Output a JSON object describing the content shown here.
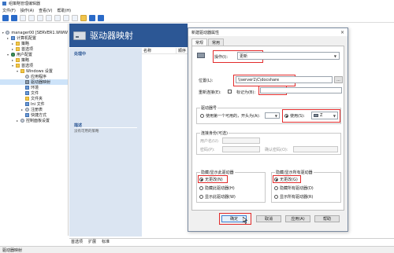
{
  "window": {
    "title": "组策略管理编辑器"
  },
  "menu": [
    "文件(F)",
    "操作(A)",
    "查看(V)",
    "帮助(H)"
  ],
  "tree": [
    {
      "label": "manager00 [SERVER1.WWW",
      "icon": "gpo-icon",
      "indent": 0,
      "twisty": "▾"
    },
    {
      "label": "计算机配置",
      "icon": "computer-config-icon",
      "indent": 1,
      "twisty": "▸"
    },
    {
      "label": "策略",
      "icon": "folder-icon",
      "indent": 2,
      "twisty": "▸"
    },
    {
      "label": "首选项",
      "icon": "folder-icon",
      "indent": 2,
      "twisty": "▸"
    },
    {
      "label": "用户配置",
      "icon": "user-config-icon",
      "indent": 1,
      "twisty": "▾"
    },
    {
      "label": "策略",
      "icon": "folder-icon",
      "indent": 2,
      "twisty": "▸"
    },
    {
      "label": "首选项",
      "icon": "folder-icon",
      "indent": 2,
      "twisty": "▾"
    },
    {
      "label": "Windows 设置",
      "icon": "folder-icon",
      "indent": 3,
      "twisty": "▾"
    },
    {
      "label": "应用程序",
      "icon": "app-icon",
      "indent": 4,
      "twisty": ""
    },
    {
      "label": "驱动器映射",
      "icon": "drive-map-icon",
      "indent": 4,
      "twisty": "",
      "selected": true
    },
    {
      "label": "环境",
      "icon": "env-icon",
      "indent": 4,
      "twisty": ""
    },
    {
      "label": "文件",
      "icon": "file-icon",
      "indent": 4,
      "twisty": ""
    },
    {
      "label": "文件夹",
      "icon": "folder-icon",
      "indent": 4,
      "twisty": ""
    },
    {
      "label": "Ini 文件",
      "icon": "ini-icon",
      "indent": 4,
      "twisty": ""
    },
    {
      "label": "注册表",
      "icon": "registry-icon",
      "indent": 4,
      "twisty": "▸"
    },
    {
      "label": "快捷方式",
      "icon": "shortcut-icon",
      "indent": 4,
      "twisty": ""
    },
    {
      "label": "控制面板设置",
      "icon": "control-panel-icon",
      "indent": 3,
      "twisty": "▸"
    }
  ],
  "center": {
    "title": "驱动器映射",
    "action_section": "处理中",
    "desc_section": "描述",
    "desc_text": "没有可用的策略",
    "col_name": "名称",
    "col_order": "顺序"
  },
  "bottom_tabs": [
    "首选项",
    "扩展",
    "标准"
  ],
  "statusbar": "驱动器映射",
  "dialog": {
    "title": "新建驱动器属性",
    "close": "×",
    "tabs": [
      "常规",
      "常用"
    ],
    "action_label": "操作(I):",
    "action_value": "更新",
    "location_label": "位置(L):",
    "location_value": "\\\\server1\\C\\docshare",
    "browse": "...",
    "reconnect_label": "重新连接(E):",
    "label_as": "标记为(B):",
    "drive_letter_group": "驱动器号",
    "use_first": "使用第一个可用的，开头为(A):",
    "use_label": "使用(S):",
    "drive_value": "Z",
    "connect_as_group": "连接身份(可选)",
    "user_name": "用户名(U):",
    "password": "密码(P):",
    "confirm_password": "确认密码(O):",
    "hide_show_drive_group": "隐藏/显示此驱动器",
    "hide_show_all_group": "隐藏/显示所有驱动器",
    "no_change_1": "无更改(N)",
    "hide_this": "隐藏此驱动器(H)",
    "show_this": "显示此驱动器(W)",
    "no_change_2": "无更改(G)",
    "hide_all": "隐藏所有驱动器(D)",
    "show_all": "显示所有驱动器(R)",
    "ok": "确定",
    "cancel": "取消",
    "apply": "应用(A)",
    "help": "帮助"
  }
}
